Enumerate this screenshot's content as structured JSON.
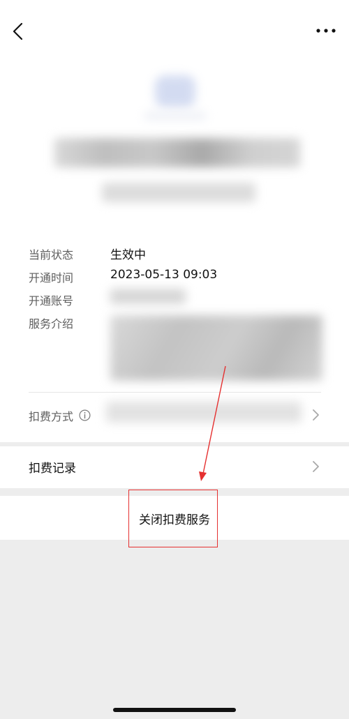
{
  "nav": {
    "back_icon": "chevron-left-icon",
    "more_icon": "more-dots-icon"
  },
  "details": {
    "status_label": "当前状态",
    "status_value": "生效中",
    "opened_time_label": "开通时间",
    "opened_time_value": "2023-05-13 09:03",
    "account_label": "开通账号",
    "description_label": "服务介绍"
  },
  "payment": {
    "method_label": "扣费方式",
    "info_icon": "info-icon",
    "chevron_icon": "chevron-right-icon"
  },
  "records": {
    "label": "扣费记录",
    "chevron_icon": "chevron-right-icon"
  },
  "close_service": {
    "label": "关闭扣费服务"
  },
  "annotation": {
    "color": "#e53030"
  }
}
